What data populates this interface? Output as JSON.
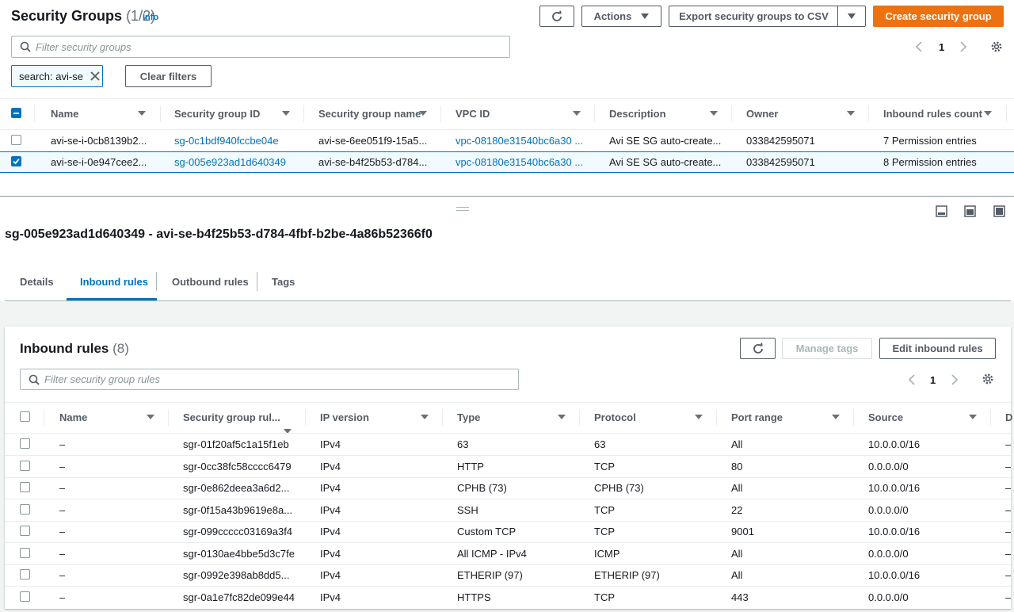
{
  "sg_list": {
    "title": "Security Groups",
    "count": "(1/2)",
    "info": "Info",
    "actions_label": "Actions",
    "export_label": "Export security groups to CSV",
    "create_label": "Create security group",
    "filter_placeholder": "Filter security groups",
    "filter_token": "search: avi-se",
    "clear_filters": "Clear filters",
    "page": "1",
    "columns": [
      "Name",
      "Security group ID",
      "Security group name",
      "VPC ID",
      "Description",
      "Owner",
      "Inbound rules count"
    ],
    "rows": [
      {
        "name": "avi-se-i-0cb8139b2...",
        "id": "sg-0c1bdf940fccbe04e",
        "sg_name": "avi-se-6ee051f9-15a5...",
        "vpc": "vpc-08180e31540bc6a30 ...",
        "desc": "Avi SE SG auto-create...",
        "owner": "033842595071",
        "inbound": "7 Permission entries",
        "selected": false
      },
      {
        "name": "avi-se-i-0e947cee2...",
        "id": "sg-005e923ad1d640349",
        "sg_name": "avi-se-b4f25b53-d784...",
        "vpc": "vpc-08180e31540bc6a30 ...",
        "desc": "Avi SE SG auto-create...",
        "owner": "033842595071",
        "inbound": "8 Permission entries",
        "selected": true
      }
    ]
  },
  "detail": {
    "heading": "sg-005e923ad1d640349 - avi-se-b4f25b53-d784-4fbf-b2be-4a86b52366f0",
    "tabs": [
      "Details",
      "Inbound rules",
      "Outbound rules",
      "Tags"
    ],
    "active_tab": "Inbound rules"
  },
  "inbound": {
    "title": "Inbound rules",
    "count": "(8)",
    "manage_tags": "Manage tags",
    "edit_label": "Edit inbound rules",
    "filter_placeholder": "Filter security group rules",
    "page": "1",
    "columns": [
      "Name",
      "Security group rul...",
      "IP version",
      "Type",
      "Protocol",
      "Port range",
      "Source",
      "D"
    ],
    "rows": [
      {
        "name": "–",
        "rule": "sgr-01f20af5c1a15f1eb",
        "ip": "IPv4",
        "type": "63",
        "protocol": "63",
        "port": "All",
        "source": "10.0.0.0/16",
        "d": "–"
      },
      {
        "name": "–",
        "rule": "sgr-0cc38fc58cccc6479",
        "ip": "IPv4",
        "type": "HTTP",
        "protocol": "TCP",
        "port": "80",
        "source": "0.0.0.0/0",
        "d": "–"
      },
      {
        "name": "–",
        "rule": "sgr-0e862deea3a6d2...",
        "ip": "IPv4",
        "type": "CPHB (73)",
        "protocol": "CPHB (73)",
        "port": "All",
        "source": "10.0.0.0/16",
        "d": "–"
      },
      {
        "name": "–",
        "rule": "sgr-0f15a43b9619e8a...",
        "ip": "IPv4",
        "type": "SSH",
        "protocol": "TCP",
        "port": "22",
        "source": "0.0.0.0/0",
        "d": "–"
      },
      {
        "name": "–",
        "rule": "sgr-099ccccc03169a3f4",
        "ip": "IPv4",
        "type": "Custom TCP",
        "protocol": "TCP",
        "port": "9001",
        "source": "10.0.0.0/16",
        "d": "–"
      },
      {
        "name": "–",
        "rule": "sgr-0130ae4bbe5d3c7fe",
        "ip": "IPv4",
        "type": "All ICMP - IPv4",
        "protocol": "ICMP",
        "port": "All",
        "source": "0.0.0.0/0",
        "d": "–"
      },
      {
        "name": "–",
        "rule": "sgr-0992e398ab8dd5...",
        "ip": "IPv4",
        "type": "ETHERIP (97)",
        "protocol": "ETHERIP (97)",
        "port": "All",
        "source": "10.0.0.0/16",
        "d": "–"
      },
      {
        "name": "–",
        "rule": "sgr-0a1e7fc82de099e44",
        "ip": "IPv4",
        "type": "HTTPS",
        "protocol": "TCP",
        "port": "443",
        "source": "0.0.0.0/0",
        "d": "–"
      }
    ]
  },
  "colors": {
    "accent": "#0073bb",
    "primary": "#ec7211"
  }
}
